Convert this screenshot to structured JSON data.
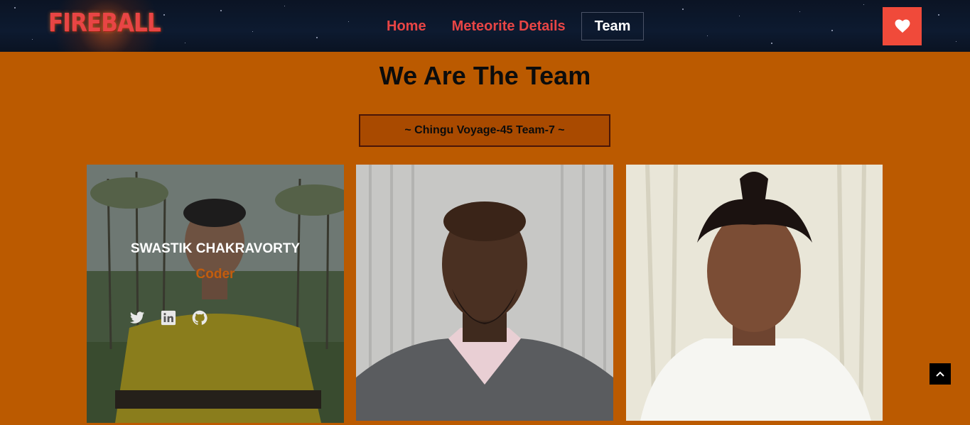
{
  "header": {
    "logo_text": "FIREBALL",
    "nav": [
      {
        "label": "Home"
      },
      {
        "label": "Meteorite Details"
      },
      {
        "label": "Team"
      }
    ],
    "favorites_icon": "heart-icon"
  },
  "main": {
    "title": "We Are The Team",
    "team_banner": "~ Chingu Voyage-45 Team-7 ~",
    "members": [
      {
        "name": "SWASTIK CHAKRAVORTY",
        "role": "Coder",
        "socials": [
          "twitter-icon",
          "linkedin-icon",
          "github-icon"
        ]
      }
    ]
  },
  "colors": {
    "page_bg": "#bb5a00",
    "accent": "#e84545",
    "favorite_button": "#f04a3a",
    "role_text": "#c25d0d"
  },
  "scroll_top_icon": "chevron-up-icon"
}
